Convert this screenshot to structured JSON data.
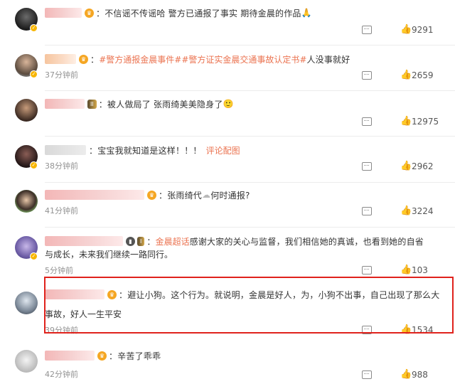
{
  "comments": [
    {
      "text_parts": [
        "：不信谣不传谣哈  警方已通报了事实  期待金晨的作品",
        "🙏"
      ],
      "time": "",
      "likes": "9291",
      "icons": {
        "reply": "reply-icon",
        "like": "thumbs-up-icon"
      }
    },
    {
      "tag1": "#警方通报金晨事件#",
      "tag2": "#警方证实金晨交通事故认定书#",
      "text": " 人没事就好",
      "time": "37分钟前",
      "likes": "2659"
    },
    {
      "level": "II",
      "text": "：被人做局了  张雨绮美美隐身了",
      "emoji": "🙂",
      "time": "",
      "likes": "12975"
    },
    {
      "text": "：宝宝我就知道是这样！！！",
      "link": "评论配图",
      "time": "38分钟前",
      "likes": "2962"
    },
    {
      "text": "：张雨绮代",
      "text_tail": "何时通报?",
      "time": "41分钟前",
      "likes": "3224"
    },
    {
      "level": "I",
      "tag": "金晨超话",
      "text": " 感谢大家的关心与监督，我们相信她的真诚，也看到她的自省",
      "text2": "与成长，未来我们继续一路同行。",
      "time": "5分钟前",
      "likes": "103"
    },
    {
      "text": "：避让小狗。这个行为。就说明，金晨是好人，为，小狗不出事，自己出现了那么大",
      "text2": "事故，好人一生平安",
      "time": "39分钟前",
      "likes": "1534"
    },
    {
      "text": "：辛苦了乖乖",
      "time": "42分钟前",
      "likes": "988"
    }
  ],
  "colors": {
    "tag": "#eb7350",
    "highlight_border": "#e0221c"
  }
}
